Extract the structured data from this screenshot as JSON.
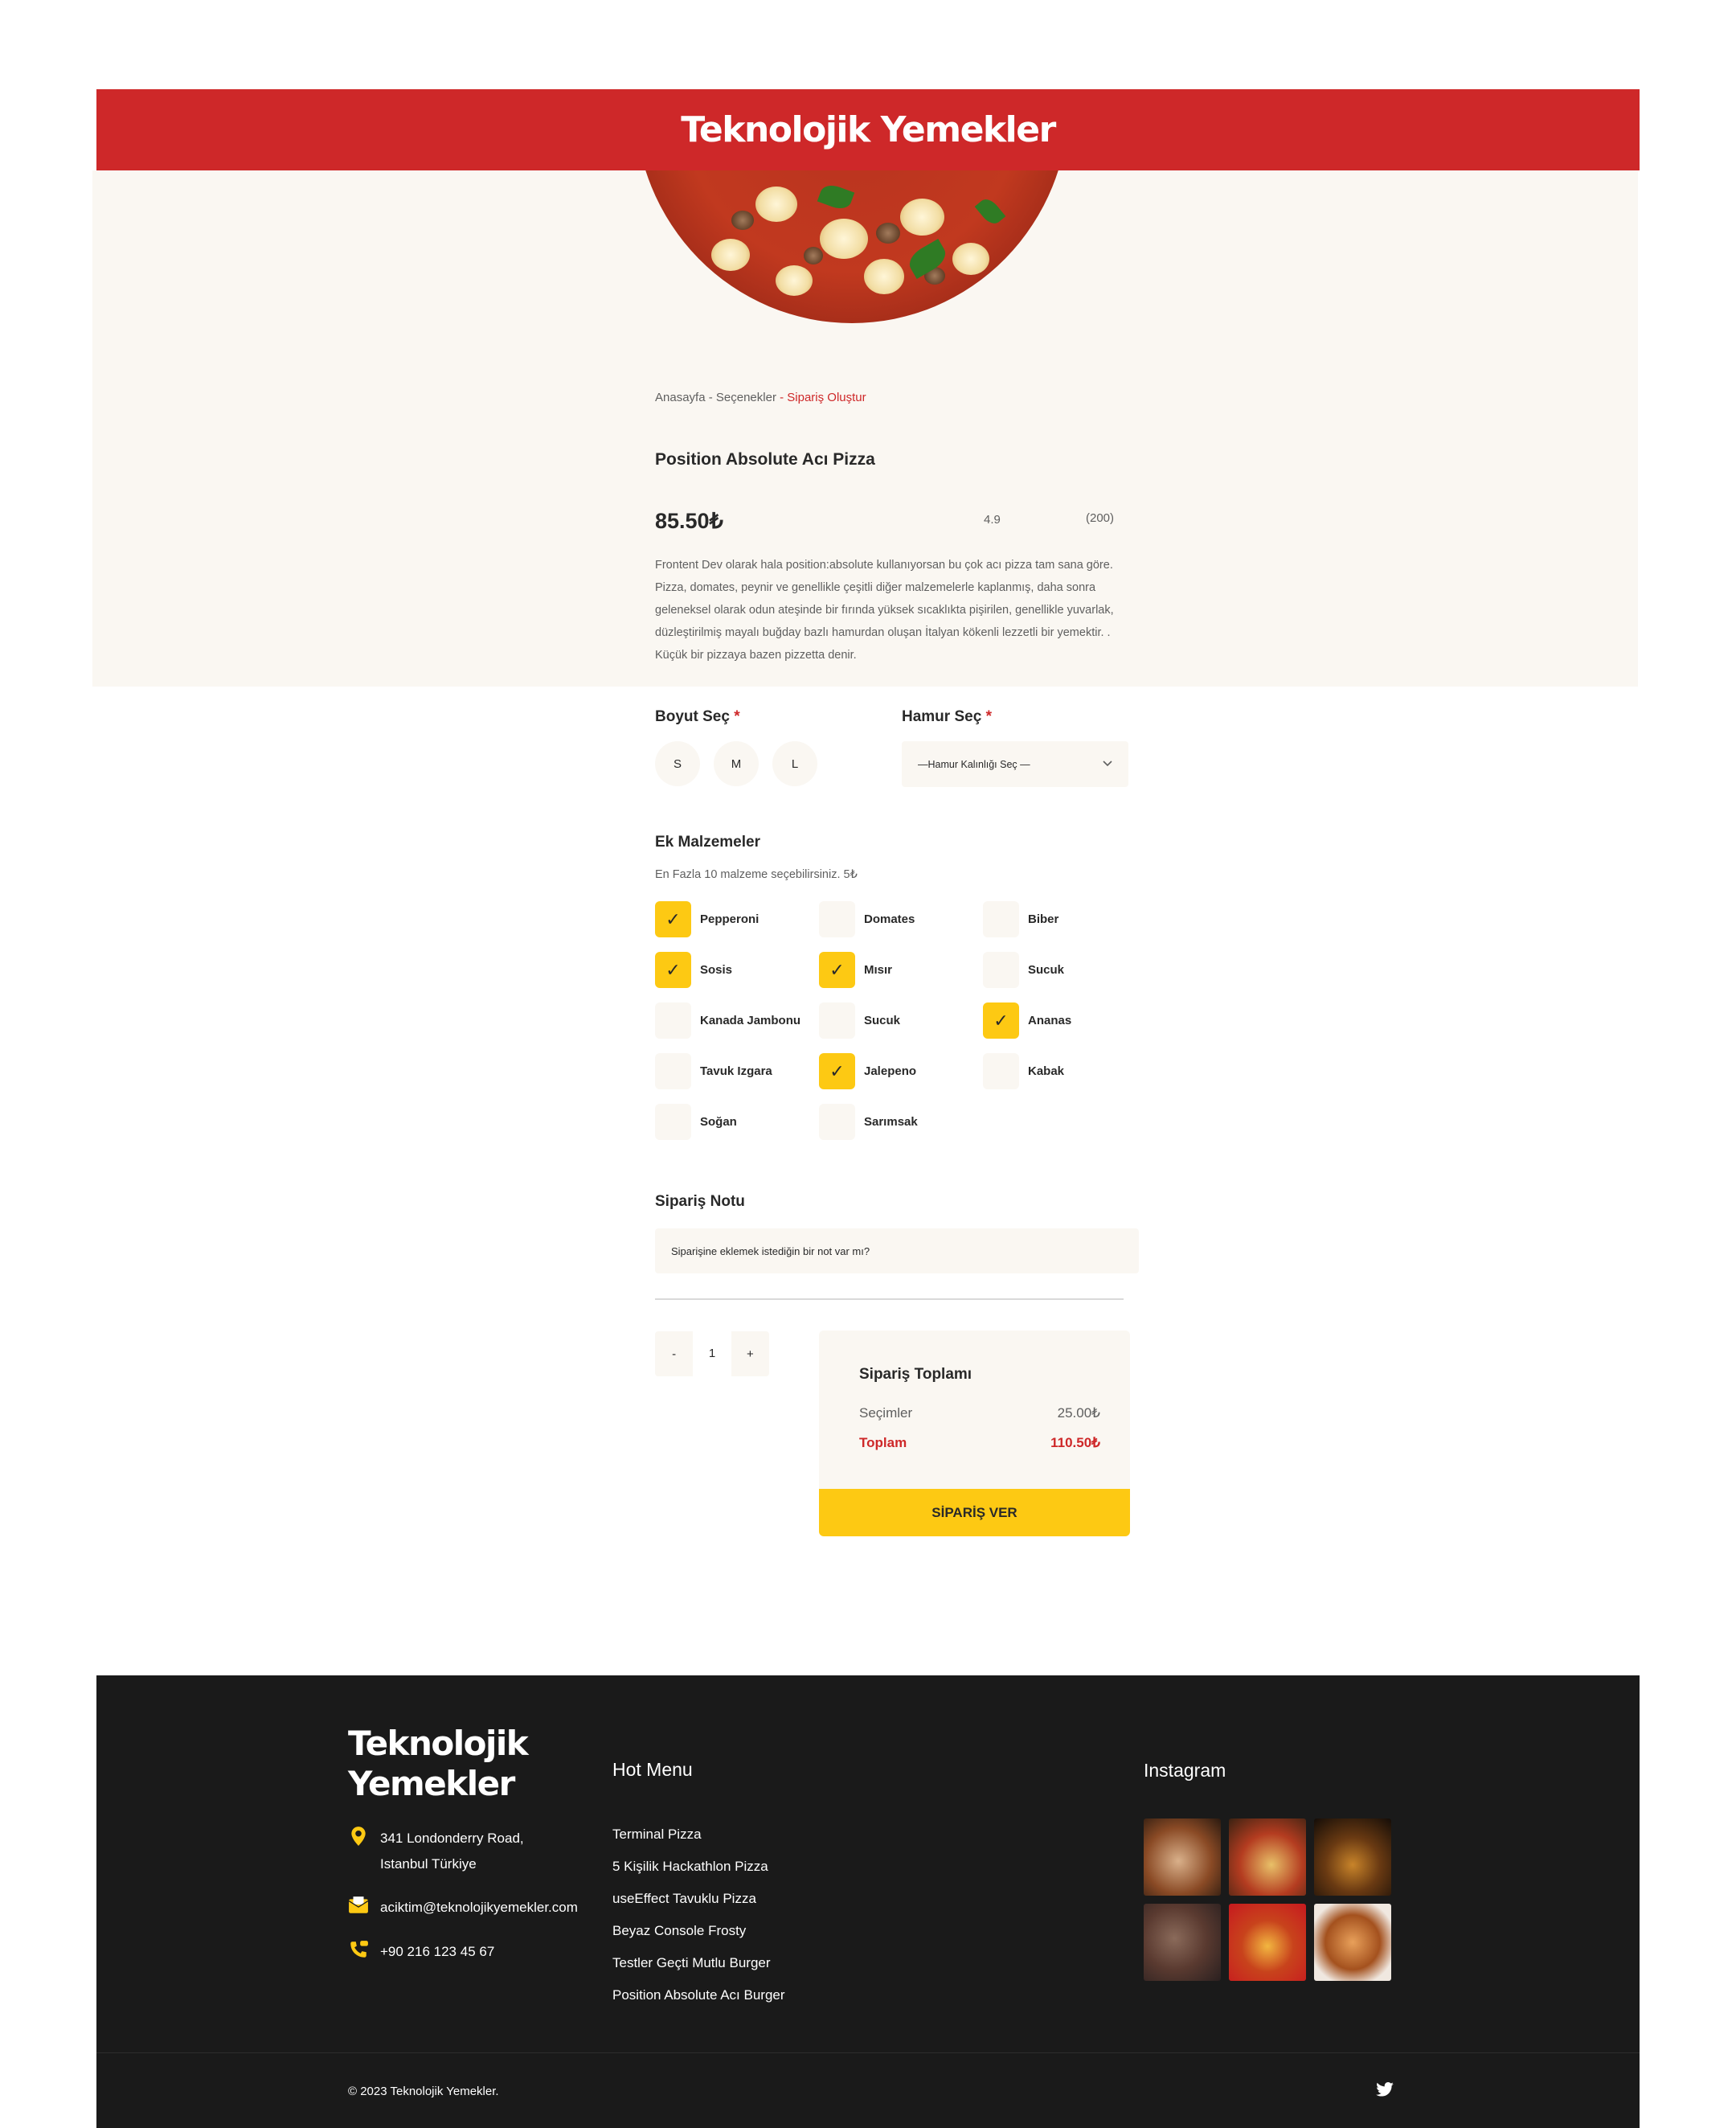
{
  "header": {
    "brand": "Teknolojik Yemekler"
  },
  "breadcrumb": {
    "home": "Anasayfa",
    "sep1": " - ",
    "options": "Seçenekler",
    "sep2": " - ",
    "current": "Sipariş Oluştur"
  },
  "product": {
    "title": "Position Absolute Acı Pizza",
    "price": "85.50₺",
    "rating": "4.9",
    "reviews": "(200)",
    "description": "Frontent Dev olarak hala position:absolute kullanıyorsan bu çok acı pizza tam sana göre. Pizza, domates, peynir ve genellikle çeşitli diğer malzemelerle kaplanmış, daha sonra geleneksel olarak odun ateşinde bir fırında yüksek sıcaklıkta pişirilen, genellikle yuvarlak, düzleştirilmiş mayalı buğday bazlı hamurdan oluşan İtalyan kökenli lezzetli bir yemektir. . Küçük bir pizzaya bazen pizzetta denir."
  },
  "size": {
    "label": "Boyut Seç",
    "required_mark": "*",
    "options": [
      "S",
      "M",
      "L"
    ]
  },
  "dough": {
    "label": "Hamur Seç",
    "required_mark": "*",
    "selected": "—Hamur Kalınlığı Seç —"
  },
  "extras": {
    "title": "Ek Malzemeler",
    "note": "En Fazla 10 malzeme seçebilirsiniz. 5₺",
    "check_mark": "✓",
    "items": [
      {
        "label": "Pepperoni",
        "checked": true
      },
      {
        "label": "Domates",
        "checked": false
      },
      {
        "label": "Biber",
        "checked": false
      },
      {
        "label": "Sosis",
        "checked": true
      },
      {
        "label": "Mısır",
        "checked": true
      },
      {
        "label": "Sucuk",
        "checked": false
      },
      {
        "label": "Kanada Jambonu",
        "checked": false
      },
      {
        "label": "Sucuk",
        "checked": false
      },
      {
        "label": "Ananas",
        "checked": true
      },
      {
        "label": "Tavuk Izgara",
        "checked": false
      },
      {
        "label": "Jalepeno",
        "checked": true
      },
      {
        "label": "Kabak",
        "checked": false
      },
      {
        "label": "Soğan",
        "checked": false
      },
      {
        "label": "Sarımsak",
        "checked": false
      }
    ]
  },
  "order_note": {
    "title": "Sipariş Notu",
    "placeholder": "Siparişine eklemek istediğin bir not var mı?"
  },
  "quantity": {
    "minus": "-",
    "value": "1",
    "plus": "+"
  },
  "summary": {
    "title": "Sipariş Toplamı",
    "selections_label": "Seçimler",
    "selections_value": "25.00₺",
    "total_label": "Toplam",
    "total_value": "110.50₺",
    "button": "SİPARİŞ VER"
  },
  "footer": {
    "brand_line1": "Teknolojik",
    "brand_line2": "Yemekler",
    "address": "341 Londonderry Road, Istanbul Türkiye",
    "email": "aciktim@teknolojikyemekler.com",
    "phone": "+90 216 123 45 67",
    "hot_menu_title": "Hot Menu",
    "hot_menu": [
      "Terminal Pizza",
      "5 Kişilik Hackathlon Pizza",
      "useEffect Tavuklu Pizza",
      "Beyaz  Console Frosty",
      "Testler Geçti Mutlu Burger",
      "Position Absolute Acı Burger"
    ],
    "instagram_title": "Instagram",
    "copyright": "© 2023 Teknolojik Yemekler."
  },
  "colors": {
    "brand_red": "#CE2829",
    "accent_yellow": "#FDC913",
    "beige": "#FAF7F2",
    "dark": "#1A1A1A"
  },
  "icons": [
    "location-pin-icon",
    "mail-icon",
    "phone-icon",
    "twitter-icon",
    "chevron-down-icon",
    "checkmark-icon"
  ]
}
